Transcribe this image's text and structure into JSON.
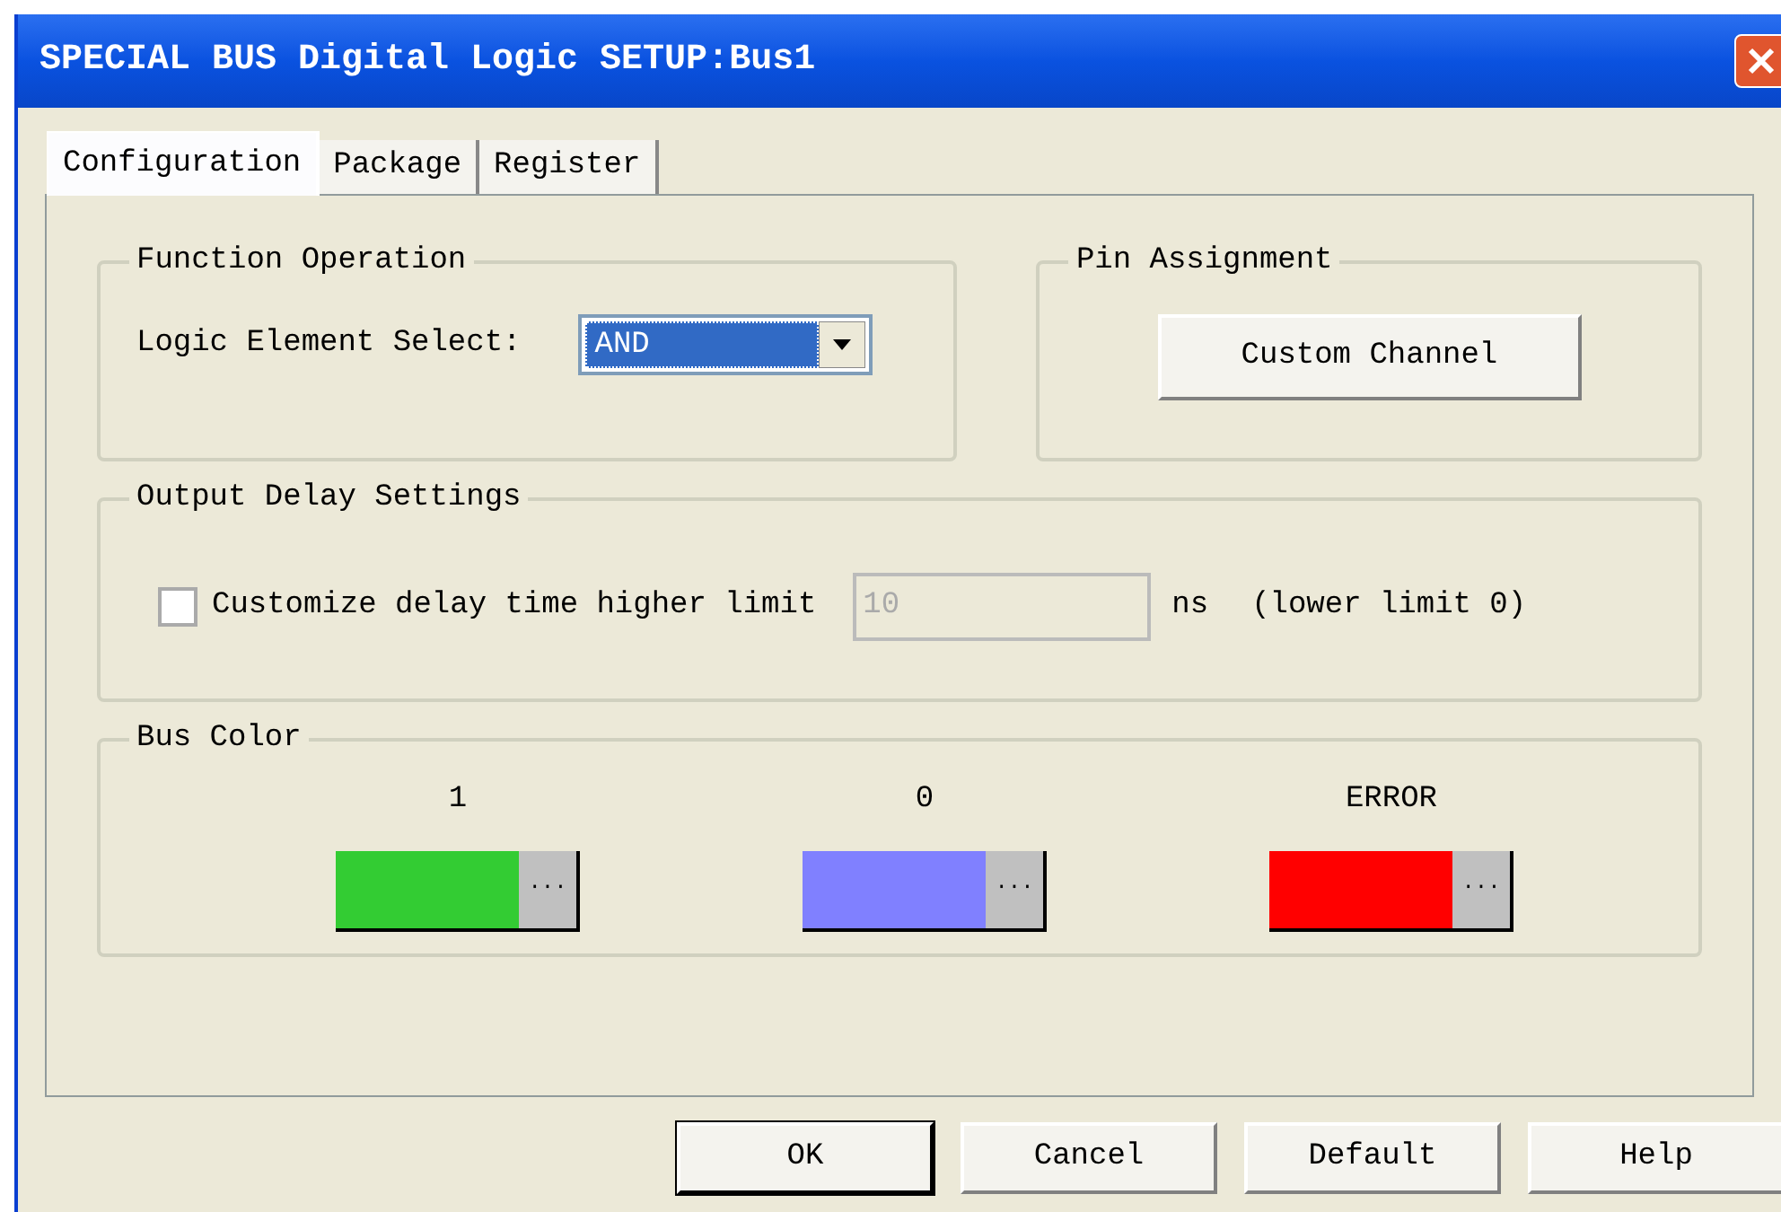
{
  "window": {
    "title": "SPECIAL BUS Digital Logic SETUP:Bus1"
  },
  "tabs": [
    {
      "label": "Configuration",
      "selected": true
    },
    {
      "label": "Package",
      "selected": false
    },
    {
      "label": "Register",
      "selected": false
    }
  ],
  "function_operation": {
    "title": "Function Operation",
    "label": "Logic Element Select:",
    "value": "AND"
  },
  "pin_assignment": {
    "title": "Pin Assignment",
    "button": "Custom Channel"
  },
  "output_delay": {
    "title": "Output Delay Settings",
    "checkbox_label": "Customize delay time higher limit",
    "checked": false,
    "value": "10",
    "disabled": true,
    "unit": "ns",
    "note": "(lower limit 0)"
  },
  "bus_color": {
    "title": "Bus Color",
    "items": [
      {
        "label": "1",
        "color": "#33cc33",
        "button": "···"
      },
      {
        "label": "0",
        "color": "#8080ff",
        "button": "···"
      },
      {
        "label": "ERROR",
        "color": "#ff0000",
        "button": "···"
      }
    ]
  },
  "buttons": [
    {
      "label": "OK",
      "default": true
    },
    {
      "label": "Cancel",
      "default": false
    },
    {
      "label": "Default",
      "default": false
    },
    {
      "label": "Help",
      "default": false
    }
  ]
}
